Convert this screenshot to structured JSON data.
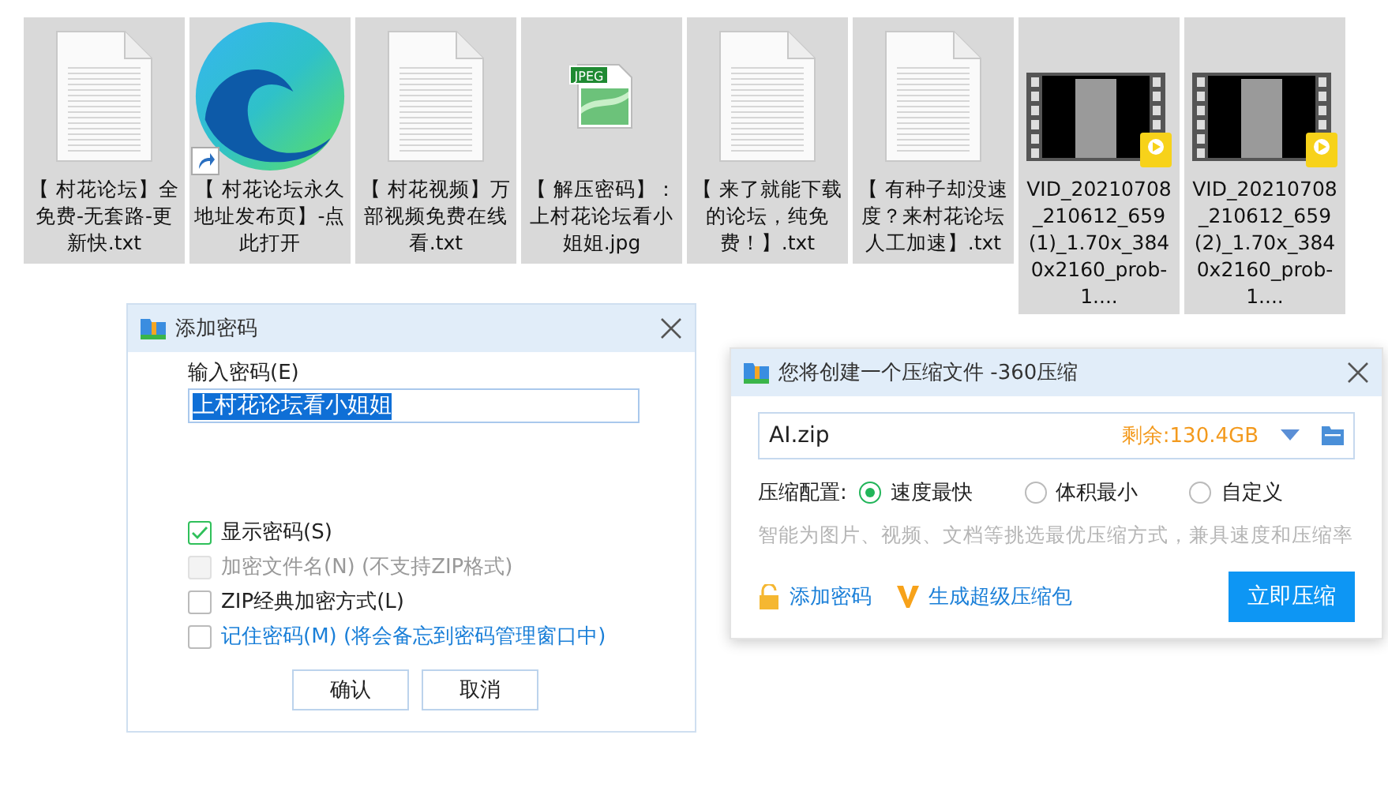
{
  "files": [
    {
      "kind": "text",
      "name": "【 村花论坛】全免费-无套路-更新快.txt",
      "selected": true
    },
    {
      "kind": "shortcut",
      "name": "【 村花论坛永久地址发布页】-点此打开",
      "selected": true
    },
    {
      "kind": "text",
      "name": "【 村花视频】万部视频免费在线看.txt",
      "selected": true
    },
    {
      "kind": "image",
      "badge": "JPEG",
      "name": "【 解压密码】：上村花论坛看小姐姐.jpg",
      "selected": true
    },
    {
      "kind": "text",
      "name": "【 来了就能下载的论坛，纯免费！】.txt",
      "selected": true
    },
    {
      "kind": "text",
      "name": "【 有种子却没速度？来村花论坛人工加速】.txt",
      "selected": true
    },
    {
      "kind": "video",
      "name": "VID_20210708_210612_659(1)_1.70x_3840x2160_prob-1....",
      "selected": true
    },
    {
      "kind": "video",
      "name": "VID_20210708_210612_659(2)_1.70x_3840x2160_prob-1....",
      "selected": true
    }
  ],
  "password_dialog": {
    "title": "添加密码",
    "field_label": "输入密码(E)",
    "value": "上村花论坛看小姐姐",
    "options": [
      {
        "kind": "plain",
        "label": "显示密码(S)",
        "checked": true,
        "disabled": false
      },
      {
        "kind": "plain",
        "label": "加密文件名(N) (不支持ZIP格式)",
        "checked": false,
        "disabled": true
      },
      {
        "kind": "plain",
        "label": "ZIP经典加密方式(L)",
        "checked": false,
        "disabled": false
      },
      {
        "kind": "link",
        "label": "记住密码(M) (将会备忘到密码管理窗口中)",
        "checked": false,
        "disabled": false
      }
    ],
    "buttons": [
      "确认",
      "取消"
    ]
  },
  "compress_dialog": {
    "title": "您将创建一个压缩文件 -360压缩",
    "filename": "AI.zip",
    "free_space": "剩余:130.4GB",
    "config_label": "压缩配置:",
    "modes": [
      {
        "label": "速度最快",
        "selected": true
      },
      {
        "label": "体积最小",
        "selected": false
      },
      {
        "label": "自定义",
        "selected": false
      }
    ],
    "hint": "智能为图片、视频、文档等挑选最优压缩方式，兼具速度和压缩率",
    "add_password": "添加密码",
    "super_pack": "生成超级压缩包",
    "button": "立即压缩"
  }
}
